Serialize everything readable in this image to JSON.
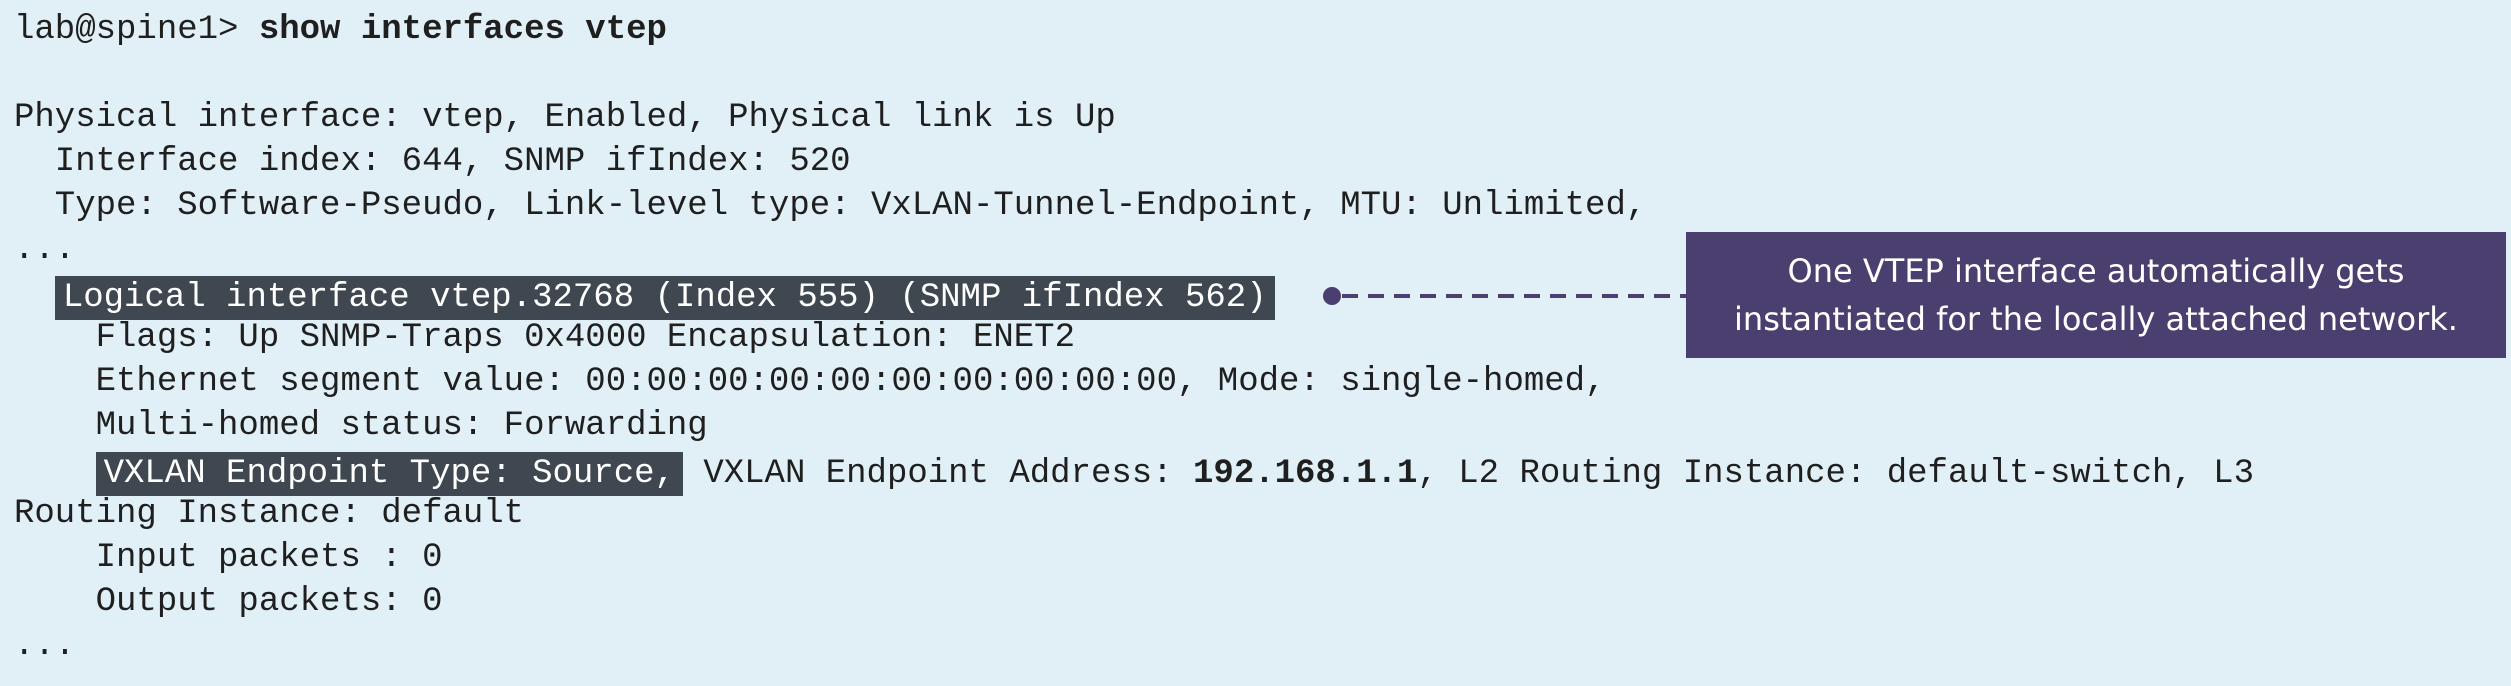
{
  "terminal": {
    "prompt": "lab@spine1> ",
    "command": "show interfaces vtep",
    "line1": "Physical interface: vtep, Enabled, Physical link is Up",
    "line2": "  Interface index: 644, SNMP ifIndex: 520",
    "line3": "  Type: Software-Pseudo, Link-level type: VxLAN-Tunnel-Endpoint, MTU: Unlimited,",
    "ellipsis1": "...",
    "logical_indent": "  ",
    "logical_interface": "Logical interface vtep.32768 (Index 555) (SNMP ifIndex 562)",
    "flags": "    Flags: Up SNMP-Traps 0x4000 Encapsulation: ENET2",
    "esi": "    Ethernet segment value: 00:00:00:00:00:00:00:00:00:00, Mode: single-homed,",
    "multihomed": "    Multi-homed status: Forwarding",
    "vxlan_indent": "    ",
    "vxlan_type": "VXLAN Endpoint Type: Source,",
    "vxlan_addr_prefix": " VXLAN Endpoint Address: ",
    "vxlan_addr": "192.168.1.1",
    "vxlan_suffix": ", L2 Routing Instance: default-switch, L3",
    "routing_instance": "Routing Instance: default",
    "input_packets": "    Input packets : 0",
    "output_packets": "    Output packets: 0",
    "ellipsis2": "..."
  },
  "callout": {
    "line1": "One VTEP interface automatically gets",
    "line2": "instantiated for the locally attached network."
  },
  "colors": {
    "background": "#e0f0f6",
    "highlight": "#3f4850",
    "callout": "#4a3f6e"
  }
}
